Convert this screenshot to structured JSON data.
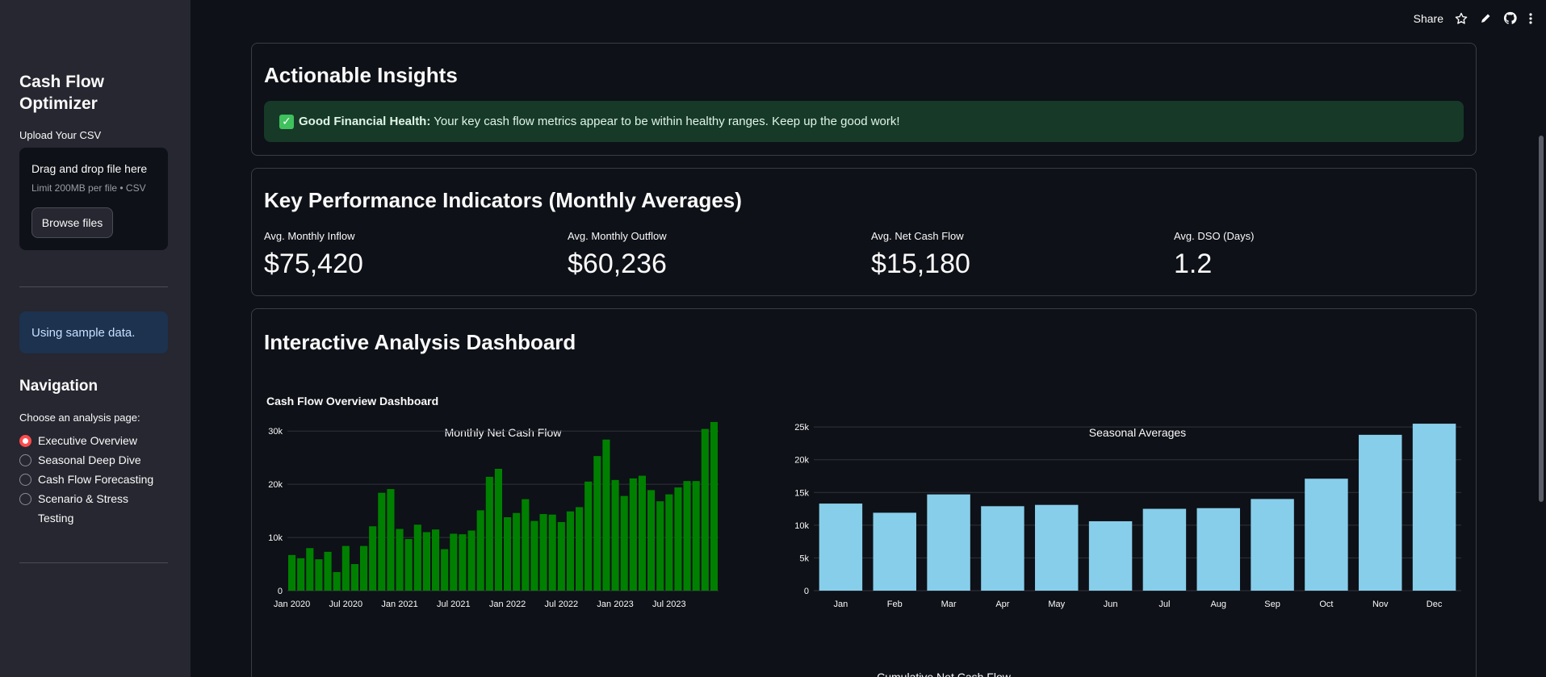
{
  "sidebar": {
    "title": "Cash Flow Optimizer",
    "upload_label": "Upload Your CSV",
    "dropzone_title": "Drag and drop file here",
    "dropzone_limit": "Limit 200MB per file • CSV",
    "browse_label": "Browse files",
    "info": "Using sample data.",
    "nav_title": "Navigation",
    "nav_sub": "Choose an analysis page:",
    "nav_options": [
      "Executive Overview",
      "Seasonal Deep Dive",
      "Cash Flow Forecasting",
      "Scenario & Stress Testing"
    ],
    "nav_selected": "Executive Overview"
  },
  "toolbar": {
    "share": "Share",
    "icons": [
      "star-icon",
      "edit-icon",
      "github-icon",
      "more-icon"
    ]
  },
  "insights": {
    "title": "Actionable Insights",
    "strong": "Good Financial Health:",
    "text": " Your key cash flow metrics appear to be within healthy ranges. Keep up the good work!"
  },
  "kpi": {
    "title": "Key Performance Indicators (Monthly Averages)",
    "metrics": [
      {
        "label": "Avg. Monthly Inflow",
        "value": "$75,420"
      },
      {
        "label": "Avg. Monthly Outflow",
        "value": "$60,236"
      },
      {
        "label": "Avg. Net Cash Flow",
        "value": "$15,180"
      },
      {
        "label": "Avg. DSO (Days)",
        "value": "1.2"
      }
    ]
  },
  "dashboard": {
    "title": "Interactive Analysis Dashboard",
    "overview_title": "Cash Flow Overview Dashboard",
    "next_chart_title": "Cumulative Net Cash Flow"
  },
  "colors": {
    "accent": "#ff4b4b",
    "bar_green": "#008000",
    "bar_blue": "#87ceeb",
    "success_bg": "#173928",
    "info_bg": "#1c324f"
  },
  "chart_data": [
    {
      "type": "bar",
      "title": "Monthly Net Cash Flow",
      "x_tick_labels": [
        "Jan 2020",
        "Jul 2020",
        "Jan 2021",
        "Jul 2021",
        "Jan 2022",
        "Jul 2022",
        "Jan 2023",
        "Jul 2023"
      ],
      "y_tick_labels": [
        "0",
        "10k",
        "20k",
        "30k"
      ],
      "ylim": [
        0,
        32000
      ],
      "series": [
        {
          "values": [
            6700,
            6100,
            8000,
            5900,
            7300,
            3500,
            8400,
            5000,
            8400,
            12100,
            18400,
            19100,
            11600,
            9700,
            12400,
            11000,
            11500,
            7800,
            10700,
            10600,
            11300,
            15100,
            21400,
            22900,
            13800,
            14600,
            17200,
            13100,
            14400,
            14300,
            12900,
            14900,
            15700,
            20500,
            25300,
            28400,
            20800,
            17800,
            21100,
            21600,
            18900,
            16800,
            18100,
            19400,
            20600,
            20600,
            30400,
            31700
          ]
        }
      ],
      "grid": true
    },
    {
      "type": "bar",
      "title": "Seasonal Averages",
      "categories": [
        "Jan",
        "Feb",
        "Mar",
        "Apr",
        "May",
        "Jun",
        "Jul",
        "Aug",
        "Sep",
        "Oct",
        "Nov",
        "Dec"
      ],
      "y_tick_labels": [
        "0",
        "5k",
        "10k",
        "15k",
        "20k",
        "25k"
      ],
      "ylim": [
        0,
        26000
      ],
      "series": [
        {
          "values": [
            13300,
            11900,
            14700,
            12900,
            13100,
            10600,
            12500,
            12600,
            14000,
            17100,
            23800,
            25500
          ]
        }
      ],
      "grid": true
    }
  ]
}
